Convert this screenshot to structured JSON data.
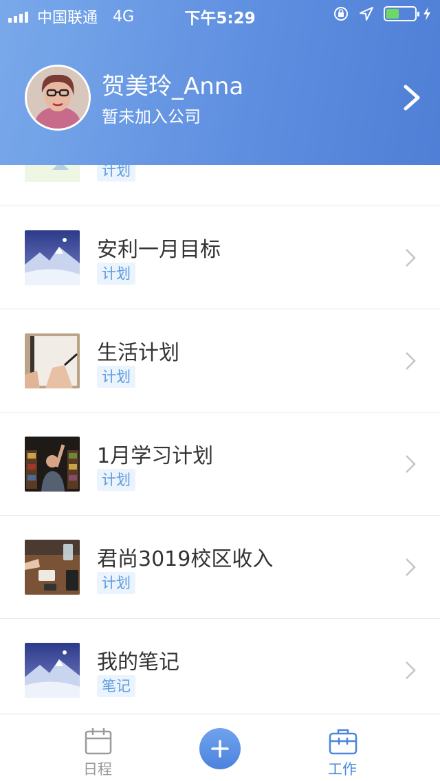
{
  "status_bar": {
    "carrier": "中国联通",
    "network": "4G",
    "time": "下午5:29",
    "battery_level": 0.45
  },
  "profile": {
    "name": "贺美玲_Anna",
    "company": "暂未加入公司"
  },
  "items": [
    {
      "title": "",
      "tag": "计划",
      "thumb": "snow-mountain"
    },
    {
      "title": "安利一月目标",
      "tag": "计划",
      "thumb": "snow-mountain"
    },
    {
      "title": "生活计划",
      "tag": "计划",
      "thumb": "notebook-writing"
    },
    {
      "title": "1月学习计划",
      "tag": "计划",
      "thumb": "library"
    },
    {
      "title": "君尚3019校区收入",
      "tag": "计划",
      "thumb": "cafe-table"
    },
    {
      "title": "我的笔记",
      "tag": "笔记",
      "thumb": "snow-mountain"
    }
  ],
  "tabbar": {
    "schedule_label": "日程",
    "work_label": "工作",
    "add_icon": "plus-icon",
    "active_color": "#4a86d9",
    "inactive_color": "#9a9a9a"
  }
}
